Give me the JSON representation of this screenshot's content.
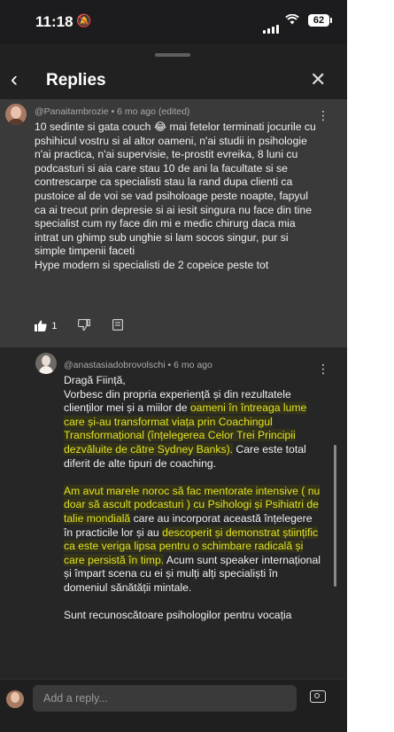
{
  "status_bar": {
    "time": "11:18",
    "bell_icon": "bell-slash-icon",
    "battery": "62"
  },
  "header": {
    "title": "Replies",
    "back_icon": "chevron-left-icon",
    "close_icon": "close-icon"
  },
  "top_comment": {
    "meta": "@Panaitambrozie • 6 mo ago (edited)",
    "text": "10 sedinte si gata couch 😂 mai fetelor terminati jocurile cu pshihicul vostru si al altor oameni,  n'ai studii  in psihologie n'ai practica, n'ai supervisie, te-prostit  evreika, 8 luni cu podcasturi si aia care stau 10 de ani la facultate si se contrescarpe ca specialisti stau la rand dupa clienti ca pustoice al de voi  se vad psiholoage peste noapte, fapyul ca ai trecut prin depresie  si ai iesit singura nu face din tine specialist cum ny face din mi e medic chirurg daca mia intrat un ghimp sub unghie si lam socos singur, pur si simple timpenii faceti\nHype modern si specialisti de 2 copeice peste tot",
    "likes": "1"
  },
  "reply": {
    "meta": "@anastasiadobrovolschi • 6 mo ago",
    "p1_plain_a": "Dragă Ființă,",
    "p1_plain_b": "Vorbesc din propria experiență și din rezultatele clienților mei și a miilor de ",
    "p1_hl_a": "oameni în întreaga lume care și-au transformat viața prin Coachingul Transformațional (înțelegerea Celor Trei Principii dezvăluite de către Sydney Banks).",
    "p1_plain_c": " Care este total diferit de alte tipuri de coaching.",
    "p2_hl_a": "Am avut marele noroc să fac mentorate intensive ( nu doar să ascult podcasturi ) cu Psihologi și Psihiatri de talie mondială",
    "p2_plain_a": " care au incorporat această înțelegere în practicile lor și au ",
    "p2_hl_b": "descoperit și demonstrat științific ca este veriga lipsa pentru o schimbare radicală și care persistă în timp.",
    "p2_plain_b": "  Acum sunt  speaker internațional și împart scena cu ei și mulți alți specialiști în domeniul sănătății mintale.",
    "p3_plain": "Sunt recunoscătoare psihologilor pentru vocația"
  },
  "input": {
    "placeholder": "Add a reply...",
    "camera_icon": "camera-icon"
  },
  "colors": {
    "highlight": "#e2e222",
    "background": "#212121"
  }
}
